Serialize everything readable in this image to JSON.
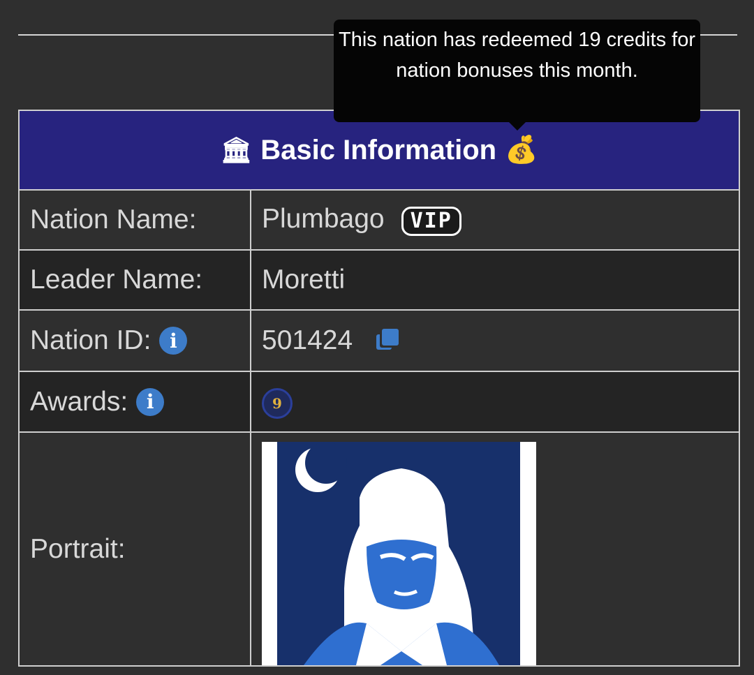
{
  "tooltip": {
    "text": "This nation has redeemed 19 credits for nation bonuses this month."
  },
  "header": {
    "title": "Basic Information",
    "bank_icon": "🏛",
    "bag_icon": "💰"
  },
  "rows": {
    "nation_name": {
      "label": "Nation Name:",
      "value": "Plumbago",
      "badge": "VIP"
    },
    "leader_name": {
      "label": "Leader Name:",
      "value": "Moretti"
    },
    "nation_id": {
      "label": "Nation ID:",
      "value": "501424"
    },
    "awards": {
      "label": "Awards:",
      "medal_number": "9"
    },
    "portrait": {
      "label": "Portrait:"
    }
  },
  "icons": {
    "info": "i"
  },
  "colors": {
    "header_bg": "#27237f",
    "accent_blue": "#3d7cc9",
    "page_bg": "#2f2f2f",
    "alt_row_bg": "#242424"
  }
}
